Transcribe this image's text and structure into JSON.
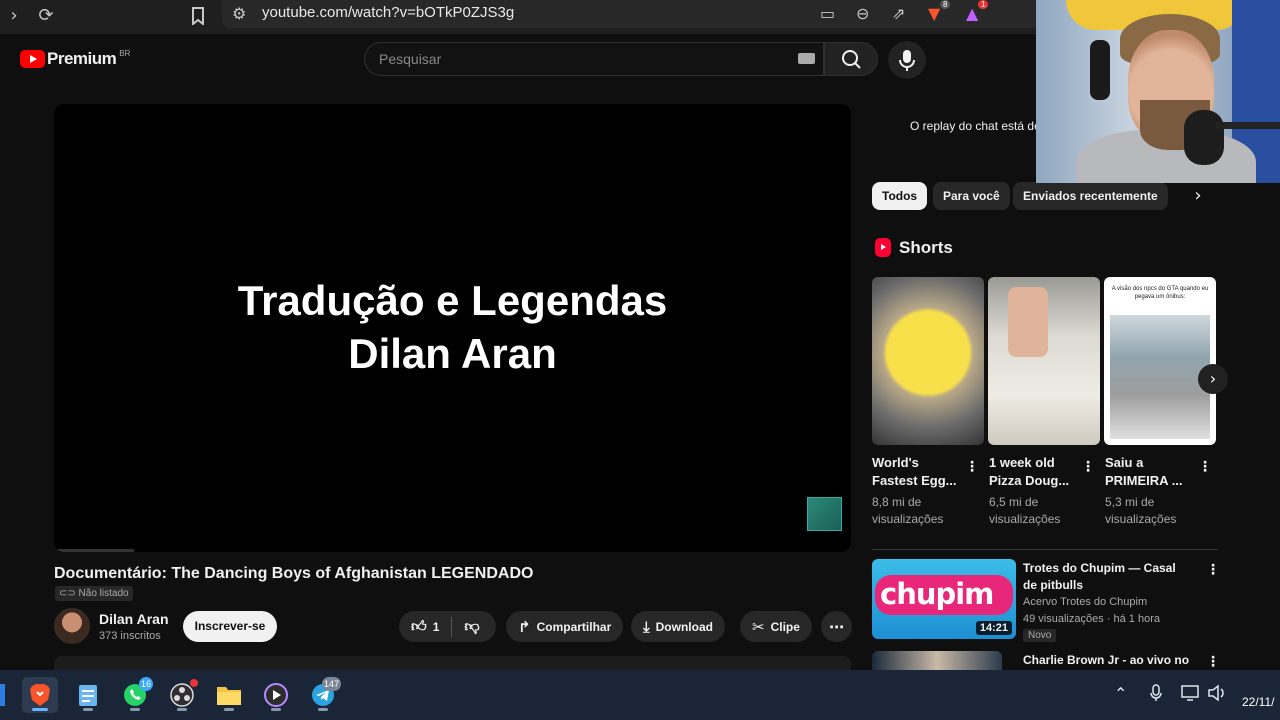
{
  "browser": {
    "url": "youtube.com/watch?v=bOTkP0ZJS3g",
    "brave_badge": "8",
    "alert_badge": "1"
  },
  "header": {
    "logo_text": "Premium",
    "logo_region": "BR",
    "search_placeholder": "Pesquisar"
  },
  "player": {
    "overlay_line1": "Tradução e Legendas",
    "overlay_line2": "Dilan Aran"
  },
  "video": {
    "title": "Documentário: The Dancing Boys of Afghanistan LEGENDADO",
    "visibility": "Não listado",
    "channel_name": "Dilan Aran",
    "subscribers": "373 inscritos",
    "subscribe_label": "Inscrever-se",
    "like_count": "1",
    "share_label": "Compartilhar",
    "download_label": "Download",
    "clip_label": "Clipe"
  },
  "sidebar": {
    "chat_replay": "O replay do chat está de",
    "chips": [
      "Todos",
      "Para você",
      "Enviados recentemente"
    ],
    "shorts_heading": "Shorts",
    "shorts": [
      {
        "title": "World's Fastest Egg...",
        "views": "8,8 mi de visualizações"
      },
      {
        "title": "1 week old Pizza Doug...",
        "views": "6,5 mi de visualizações"
      },
      {
        "title": "Saiu a PRIMEIRA ...",
        "views": "5,3 mi de visualizações",
        "thumb_caption": "A visão dos npcs do GTA quando eu pegava um ônibus:"
      }
    ],
    "recommended": [
      {
        "title": "Trotes do Chupim — Casal de pitbulls",
        "channel": "Acervo Trotes do Chupim",
        "meta": "49 visualizações · há 1 hora",
        "badge": "Novo",
        "duration": "14:21",
        "thumb_text": "chupim"
      },
      {
        "title": "Charlie Brown Jr - ao vivo no"
      }
    ]
  },
  "taskbar": {
    "whatsapp_badge": "16",
    "telegram_badge": "147",
    "clock": "22/11/"
  }
}
